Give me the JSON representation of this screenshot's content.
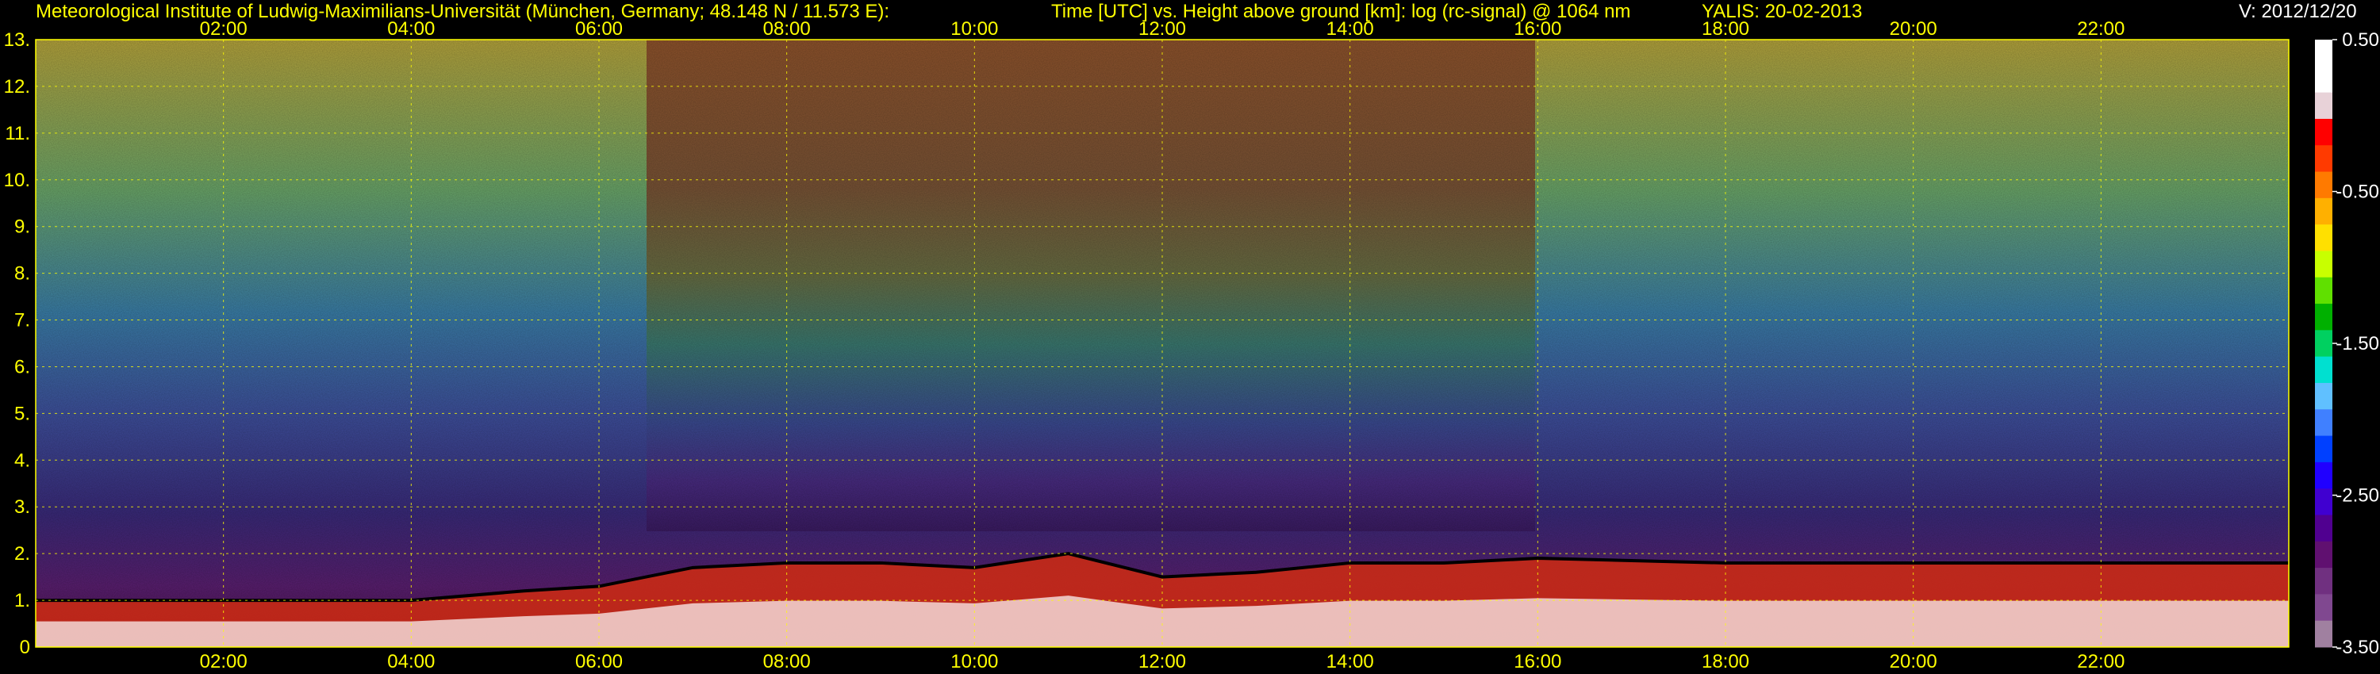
{
  "header": {
    "institute": "Meteorological Institute of Ludwig-Maximilians-Universität (München, Germany; 48.148 N / 11.573 E):",
    "description": "Time [UTC] vs. Height above ground [km]: log (rc-signal) @ 1064 nm",
    "station": "YALIS: 20-02-2013",
    "version": "V: 2012/12/20"
  },
  "chart_data": {
    "type": "heatmap",
    "title": "Time [UTC] vs. Height above ground [km]: log (rc-signal) @ 1064 nm",
    "xlabel": "Time [UTC]",
    "ylabel": "Height above ground [km]",
    "x_ticks": [
      "02:00",
      "04:00",
      "06:00",
      "08:00",
      "10:00",
      "12:00",
      "14:00",
      "16:00",
      "18:00",
      "20:00",
      "22:00"
    ],
    "x_tick_hours": [
      2,
      4,
      6,
      8,
      10,
      12,
      14,
      16,
      18,
      20,
      22
    ],
    "xlim_hours": [
      0,
      24
    ],
    "y_ticks": [
      "0",
      "1.",
      "2.",
      "3.",
      "4.",
      "5.",
      "6.",
      "7.",
      "8.",
      "9.",
      "10.",
      "11.",
      "12.",
      "13."
    ],
    "y_tick_values": [
      0,
      1,
      2,
      3,
      4,
      5,
      6,
      7,
      8,
      9,
      10,
      11,
      12,
      13
    ],
    "ylim_km": [
      0,
      13
    ],
    "grid": true,
    "colorbar": {
      "ticks": [
        "0.50",
        "-0.50",
        "-1.50",
        "-2.50",
        "-3.50"
      ],
      "tick_values": [
        0.5,
        -0.5,
        -1.5,
        -2.5,
        -3.5
      ],
      "range": [
        -3.5,
        0.5
      ],
      "colors": [
        "#ffffff",
        "#ffffff",
        "#e8d2d8",
        "#ff0000",
        "#ff3a00",
        "#ff7a00",
        "#ffb000",
        "#ffe000",
        "#c8ff00",
        "#60e000",
        "#00b000",
        "#00d060",
        "#00e0d0",
        "#60c0ff",
        "#4080ff",
        "#0040ff",
        "#2000ff",
        "#4000d0",
        "#500090",
        "#601070",
        "#703080",
        "#804890",
        "#a080a0"
      ]
    },
    "boundary_layer_top_km": [
      {
        "hour": 0.0,
        "km": 1.0
      },
      {
        "hour": 2.0,
        "km": 1.0
      },
      {
        "hour": 4.0,
        "km": 1.0
      },
      {
        "hour": 5.2,
        "km": 1.2
      },
      {
        "hour": 6.0,
        "km": 1.3
      },
      {
        "hour": 7.0,
        "km": 1.7
      },
      {
        "hour": 8.0,
        "km": 1.8
      },
      {
        "hour": 9.0,
        "km": 1.8
      },
      {
        "hour": 10.0,
        "km": 1.7
      },
      {
        "hour": 11.0,
        "km": 2.0
      },
      {
        "hour": 12.0,
        "km": 1.5
      },
      {
        "hour": 13.0,
        "km": 1.6
      },
      {
        "hour": 14.0,
        "km": 1.8
      },
      {
        "hour": 15.0,
        "km": 1.8
      },
      {
        "hour": 16.0,
        "km": 1.9
      },
      {
        "hour": 18.0,
        "km": 1.8
      },
      {
        "hour": 20.0,
        "km": 1.8
      },
      {
        "hour": 22.0,
        "km": 1.8
      },
      {
        "hour": 24.0,
        "km": 1.8
      }
    ]
  },
  "colors": {
    "axis_text": "#ffff00",
    "grid": "#ffff00",
    "background": "#000000",
    "colorbar_text": "#ffffff"
  }
}
